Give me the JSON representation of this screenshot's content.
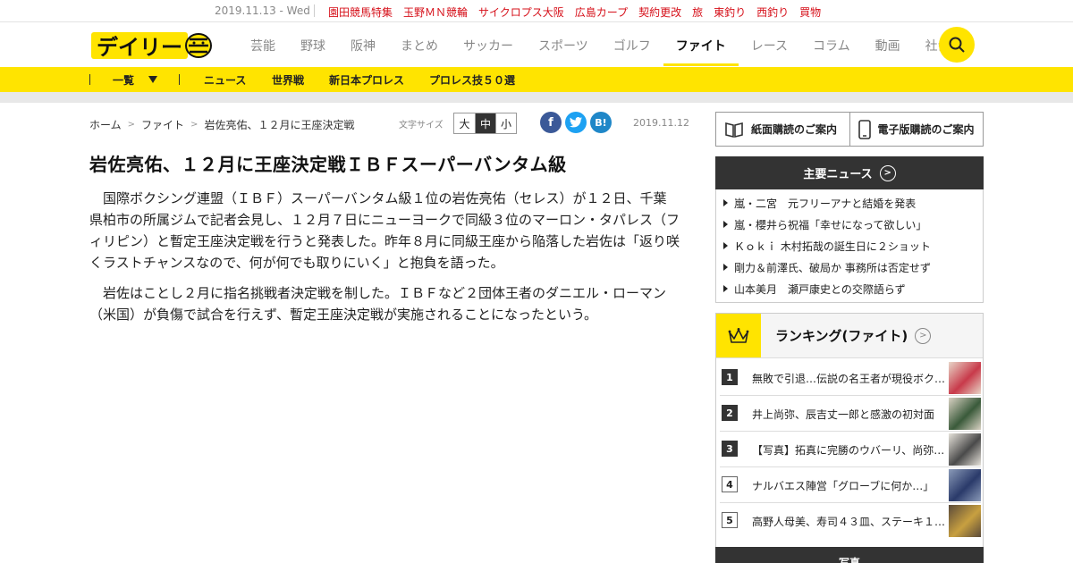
{
  "topbar": {
    "date": "2019.11.13 - Wed",
    "links": [
      "園田競馬特集",
      "玉野ＭＮ競輪",
      "サイクロプス大阪",
      "広島カープ",
      "契約更改",
      "旅",
      "東釣り",
      "西釣り",
      "買物"
    ]
  },
  "header": {
    "logo_text": "デイリー",
    "nav": [
      {
        "label": "芸能",
        "active": false
      },
      {
        "label": "野球",
        "active": false
      },
      {
        "label": "阪神",
        "active": false
      },
      {
        "label": "まとめ",
        "active": false
      },
      {
        "label": "サッカー",
        "active": false
      },
      {
        "label": "スポーツ",
        "active": false
      },
      {
        "label": "ゴルフ",
        "active": false
      },
      {
        "label": "ファイト",
        "active": true
      },
      {
        "label": "レース",
        "active": false
      },
      {
        "label": "コラム",
        "active": false
      },
      {
        "label": "動画",
        "active": false
      },
      {
        "label": "社会",
        "active": false
      }
    ],
    "search_icon": "search-icon"
  },
  "subnav": {
    "list_label": "一覧",
    "items": [
      "ニュース",
      "世界戦",
      "新日本プロレス",
      "プロレス技５０選"
    ]
  },
  "breadcrumb": {
    "home": "ホーム",
    "category": "ファイト",
    "current": "岩佐亮佑、１２月に王座決定戦"
  },
  "font_size": {
    "label": "文字サイズ",
    "options": [
      "大",
      "中",
      "小"
    ],
    "selected": "中"
  },
  "share": {
    "facebook": "f",
    "twitter": "t",
    "hatena": "B!"
  },
  "article": {
    "date": "2019.11.12",
    "headline": "岩佐亮佑、１２月に王座決定戦ＩＢＦスーパーバンタム級",
    "paragraphs": [
      "国際ボクシング連盟（ＩＢＦ）スーパーバンタム級１位の岩佐亮佑（セレス）が１２日、千葉県柏市の所属ジムで記者会見し、１２月７日にニューヨークで同級３位のマーロン・タパレス（フィリピン）と暫定王座決定戦を行うと発表した。昨年８月に同級王座から陥落した岩佐は「返り咲くラストチャンスなので、何が何でも取りにいく」と抱負を語った。",
      "岩佐はことし２月に指名挑戦者決定戦を制した。ＩＢＦなど２団体王者のダニエル・ローマン（米国）が負傷で試合を行えず、暫定王座決定戦が実施されることになったという。"
    ]
  },
  "sidebar": {
    "subscriptions": [
      "紙面購読のご案内",
      "電子版購読のご案内"
    ],
    "major_news": {
      "title": "主要ニュース",
      "items": [
        "嵐・二宮　元フリーアナと結婚を発表",
        "嵐・櫻井ら祝福「幸せになって欲しい」",
        "Ｋｏｋｉ 木村拓哉の誕生日に２ショット",
        "剛力＆前澤氏、破局か 事務所は否定せず",
        "山本美月　瀬戸康史との交際語らず"
      ]
    },
    "ranking": {
      "title": "ランキング(ファイト)",
      "items": [
        {
          "rank": "1",
          "text": "無敗で引退…伝説の名王者が現役ボク…"
        },
        {
          "rank": "2",
          "text": "井上尚弥、辰吉丈一郎と感激の初対面"
        },
        {
          "rank": "3",
          "text": "【写真】拓真に完勝のウバーリ、尚弥…"
        },
        {
          "rank": "4",
          "text": "ナルバエス陣営「グローブに何か…」"
        },
        {
          "rank": "5",
          "text": "高野人母美、寿司４３皿、ステーキ１…"
        }
      ]
    },
    "photo_title": "写真"
  },
  "colors": {
    "accent_yellow": "#ffe400",
    "topbar_red": "#d6101a",
    "dark": "#333333"
  }
}
